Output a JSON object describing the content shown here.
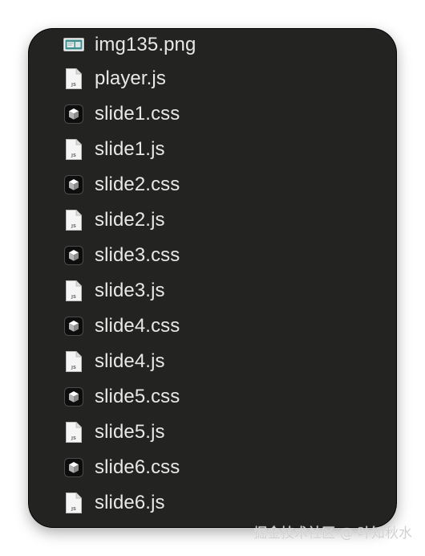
{
  "files": [
    {
      "name": "img135.png",
      "icon": "png-image-icon"
    },
    {
      "name": "player.js",
      "icon": "js-file-icon"
    },
    {
      "name": "slide1.css",
      "icon": "css-file-icon"
    },
    {
      "name": "slide1.js",
      "icon": "js-file-icon"
    },
    {
      "name": "slide2.css",
      "icon": "css-file-icon"
    },
    {
      "name": "slide2.js",
      "icon": "js-file-icon"
    },
    {
      "name": "slide3.css",
      "icon": "css-file-icon"
    },
    {
      "name": "slide3.js",
      "icon": "js-file-icon"
    },
    {
      "name": "slide4.css",
      "icon": "css-file-icon"
    },
    {
      "name": "slide4.js",
      "icon": "js-file-icon"
    },
    {
      "name": "slide5.css",
      "icon": "css-file-icon"
    },
    {
      "name": "slide5.js",
      "icon": "js-file-icon"
    },
    {
      "name": "slide6.css",
      "icon": "css-file-icon"
    },
    {
      "name": "slide6.js",
      "icon": "js-file-icon"
    }
  ],
  "js_icon_label": "JS",
  "watermark": "掘金技术社区 @ 叶知秋水",
  "colors": {
    "panel_background": "#232322",
    "text": "#e8e8e6",
    "page_background": "#ffffff"
  }
}
